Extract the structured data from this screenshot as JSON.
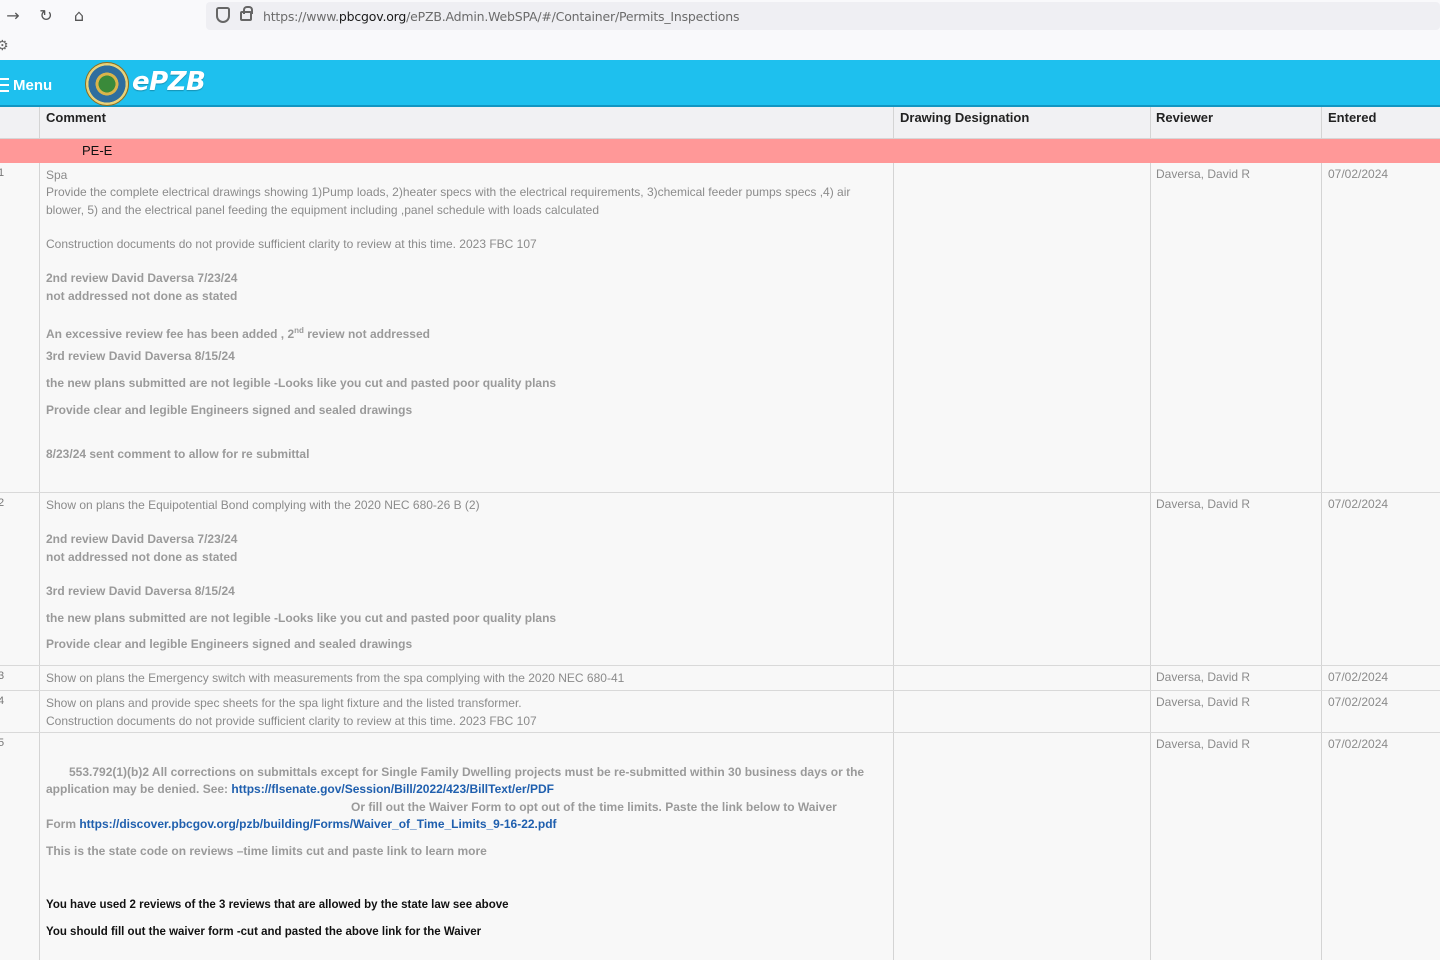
{
  "browser": {
    "url_prefix": "https://www.",
    "url_domain": "pbcgov.org",
    "url_path": "/ePZB.Admin.WebSPA/#/Container/Permits_Inspections"
  },
  "app": {
    "menu_label": "Menu",
    "brand": "ePZB"
  },
  "table": {
    "columns": {
      "comment": "Comment",
      "drawing": "Drawing Designation",
      "reviewer": "Reviewer",
      "entered": "Entered"
    },
    "group": "PE-E",
    "rows": [
      {
        "num": "1",
        "reviewer": "Daversa, David R",
        "entered": "07/02/2024",
        "lines": [
          "Spa",
          "Provide the complete electrical drawings showing 1)Pump loads, 2)heater specs with the electrical requirements, 3)chemical feeder pumps specs ,4) air",
          "blower, 5) and the electrical panel feeding the equipment  including ,panel schedule with loads calculated",
          "Construction documents do not provide sufficient clarity to review at this time. 2023 FBC 107",
          "2nd review David Daversa 7/23/24",
          "not addressed not done as stated",
          "An excessive review fee has been added , 2",
          "nd",
          " review not addressed",
          "3rd review David Daversa  8/15/24",
          "the new plans submitted are not legible -Looks like you cut and pasted poor quality plans",
          "Provide clear and legible  Engineers signed and sealed drawings",
          "8/23/24  sent comment to allow for re submittal"
        ]
      },
      {
        "num": "2",
        "reviewer": "Daversa, David R",
        "entered": "07/02/2024",
        "lines": [
          "Show on plans the Equipotential Bond complying with the 2020 NEC 680-26 B (2)",
          "2nd review David Daversa 7/23/24",
          "not addressed not done as stated",
          "3rd review David Daversa  8/15/24",
          "the new plans submitted are not legible -Looks like you cut and pasted poor quality plans",
          "Provide clear and legible  Engineers signed and sealed drawings"
        ]
      },
      {
        "num": "3",
        "reviewer": "Daversa, David R",
        "entered": "07/02/2024",
        "lines": [
          "Show on plans the Emergency switch with measurements from the spa complying with the 2020 NEC 680-41"
        ]
      },
      {
        "num": "4",
        "reviewer": "Daversa, David R",
        "entered": "07/02/2024",
        "lines": [
          "Show on plans and provide spec sheets for the spa light fixture and the listed transformer.",
          "Construction documents do not provide sufficient clarity to review at this time. 2023 FBC 107"
        ]
      },
      {
        "num": "5",
        "reviewer": "Daversa, David R",
        "entered": "07/02/2024",
        "lines": [
          "553.792(1)(b)2  All corrections on submittals except for Single Family Dwelling projects must be re-submitted within 30 business days or the",
          "application may be denied.  See: ",
          "https://flsenate.gov/Session/Bill/2022/423/BillText/er/PDF",
          "Or fill out the Waiver Form to opt out of the time limits. Paste the link below to Waiver",
          "Form ",
          "https://discover.pbcgov.org/pzb/building/Forms/Waiver_of_Time_Limits_9-16-22.pdf",
          "This is the state code on reviews –time limits  cut and paste link to learn more",
          "You have used  2 reviews of the 3 reviews that are allowed by the state law see above",
          "You should fill out the waiver form -cut and pasted the above link for the Waiver"
        ]
      }
    ]
  }
}
